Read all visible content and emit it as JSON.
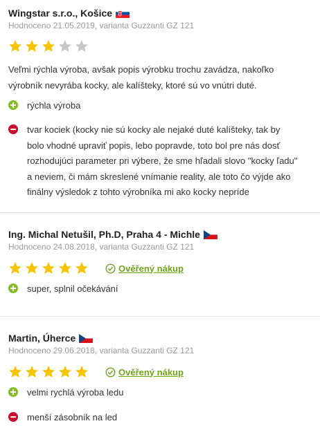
{
  "colors": {
    "star_filled": "#f6c400",
    "star_empty": "#c8c8c8",
    "plus": "#86bc25",
    "minus": "#c8102e",
    "verified": "#6ea61a"
  },
  "reviews": [
    {
      "author": "Wingstar s.r.o., Košice",
      "flag": "SK",
      "meta": "Hodnoceno 21.05.2019, varianta Guzzanti GZ 121",
      "rating": 3,
      "verified": "",
      "text": "Veľmi rýchla výroba, avšak popis výrobku trochu zavádza, nakoľko výrobník nevyrába kocky, ale kalíšteky, ktoré sú vo vnútri duté.",
      "pros": [
        "rýchla výroba"
      ],
      "cons": [
        "tvar kociek (kocky nie sú kocky ale nejaké duté kalíšteky, tak by bolo vhodné upraviť popis, lebo popravde, toto bol pre nás dosť rozhodujúci parameter pri výbere, že sme hľadali slovo \"kocky ľadu\" a neviem, či mám skreslené vnímanie reality, ale toto čo výjde ako finálny výsledok z tohto výrobníka mi ako kocky nepríde"
      ]
    },
    {
      "author": "Ing. Michal Netušil, Ph.D, Praha 4 - Michle",
      "flag": "CZ",
      "meta": "Hodnoceno 24.08.2018, varianta Guzzanti GZ 121",
      "rating": 5,
      "verified": "Ověřený nákup",
      "text": "",
      "pros": [
        "super, splnil očekávání"
      ],
      "cons": []
    },
    {
      "author": "Martin, Úherce",
      "flag": "CZ",
      "meta": "Hodnoceno 29.06.2018, varianta Guzzanti GZ 121",
      "rating": 5,
      "verified": "Ověřený nákup",
      "text": "",
      "pros": [
        "velmi rychlá výroba ledu"
      ],
      "cons": [
        "menší zásobník na led"
      ]
    }
  ]
}
